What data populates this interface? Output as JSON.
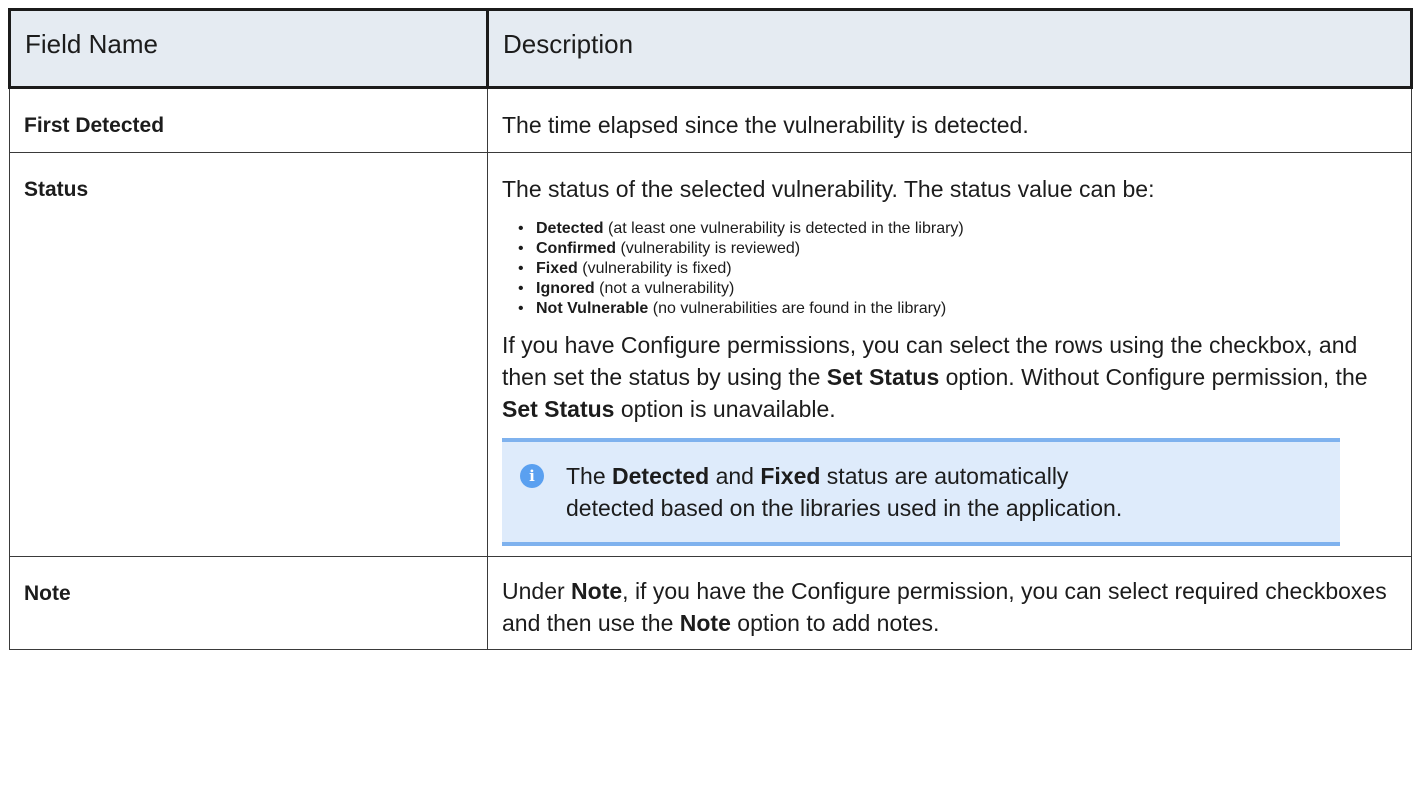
{
  "table": {
    "headers": {
      "field_name": "Field Name",
      "description": "Description"
    },
    "rows": {
      "first_detected": {
        "field": "First Detected",
        "description": "The time elapsed since the vulnerability is detected."
      },
      "status": {
        "field": "Status",
        "intro": "The status of the selected vulnerability. The status value can be:",
        "values": [
          {
            "name": "Detected",
            "text": " (at least one vulnerability is detected in the library)"
          },
          {
            "name": "Confirmed",
            "text": " (vulnerability is reviewed)"
          },
          {
            "name": "Fixed",
            "text": " (vulnerability is fixed)"
          },
          {
            "name": "Ignored",
            "text": " (not a vulnerability)"
          },
          {
            "name": "Not Vulnerable",
            "text": " (no vulnerabilities are found in the library)"
          }
        ],
        "configure": {
          "part1": "If you have Configure permissions, you can select the rows using the checkbox, and then set the status by using the ",
          "bold1": "Set Status",
          "part2": " option. Without Configure permission, the ",
          "bold2": "Set Status",
          "part3": " option is unavailable."
        },
        "info": {
          "icon": "info-icon",
          "part1": "The ",
          "bold1": "Detected",
          "part2": " and ",
          "bold2": "Fixed",
          "part3": " status are automatically detected based on the libraries used in the application."
        }
      },
      "note": {
        "field": "Note",
        "part1": "Under ",
        "bold1": "Note",
        "part2": ", if you have the Configure permission, you can select required checkboxes and then use the ",
        "bold2": "Note",
        "part3": " option to add notes."
      }
    }
  },
  "colors": {
    "header_bg": "#e5ebf2",
    "info_bg": "#deebfb",
    "info_border": "#7fb2ee",
    "info_icon": "#5aa0f0"
  }
}
